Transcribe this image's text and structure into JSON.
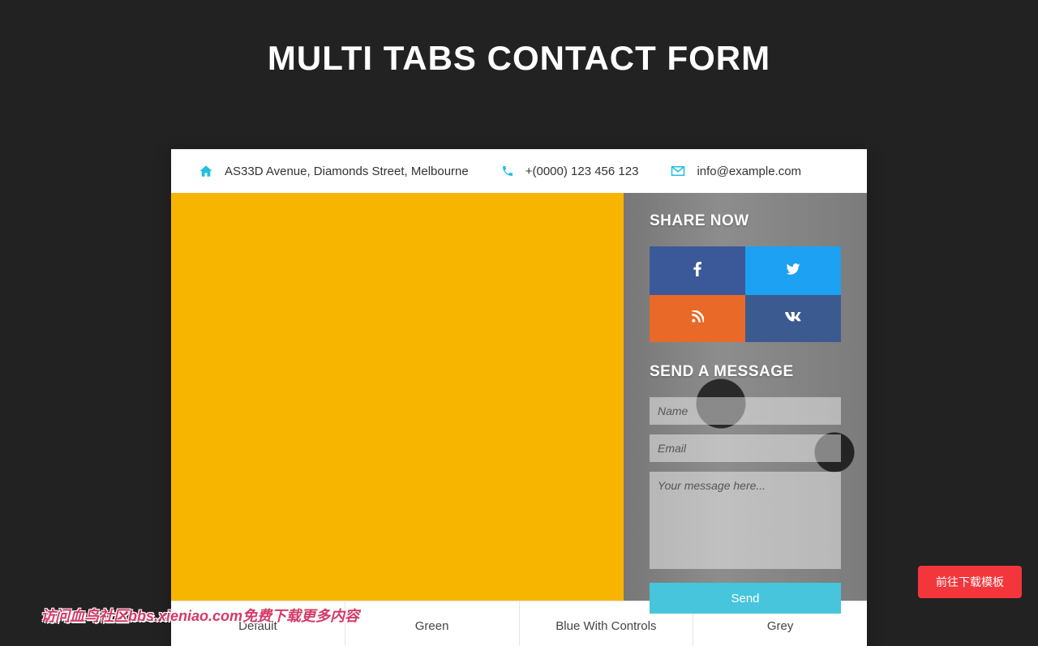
{
  "page": {
    "title": "MULTI TABS CONTACT FORM"
  },
  "info": {
    "address": "AS33D Avenue, Diamonds Street, Melbourne",
    "phone": "+(0000) 123 456 123",
    "email": "info@example.com"
  },
  "sidebar": {
    "share_title": "SHARE NOW",
    "form_title": "SEND A MESSAGE"
  },
  "social": {
    "facebook": "Facebook",
    "twitter": "Twitter",
    "rss": "RSS",
    "vk": "VK"
  },
  "form": {
    "name_placeholder": "Name",
    "email_placeholder": "Email",
    "message_placeholder": "Your message here...",
    "send_label": "Send"
  },
  "tabs": {
    "default": "Default",
    "green": "Green",
    "blue": "Blue With Controls",
    "grey": "Grey"
  },
  "cta": {
    "label": "前往下载模板"
  },
  "watermark": {
    "text": "访问血鸟社区bbs.xieniao.com免费下载更多内容"
  }
}
